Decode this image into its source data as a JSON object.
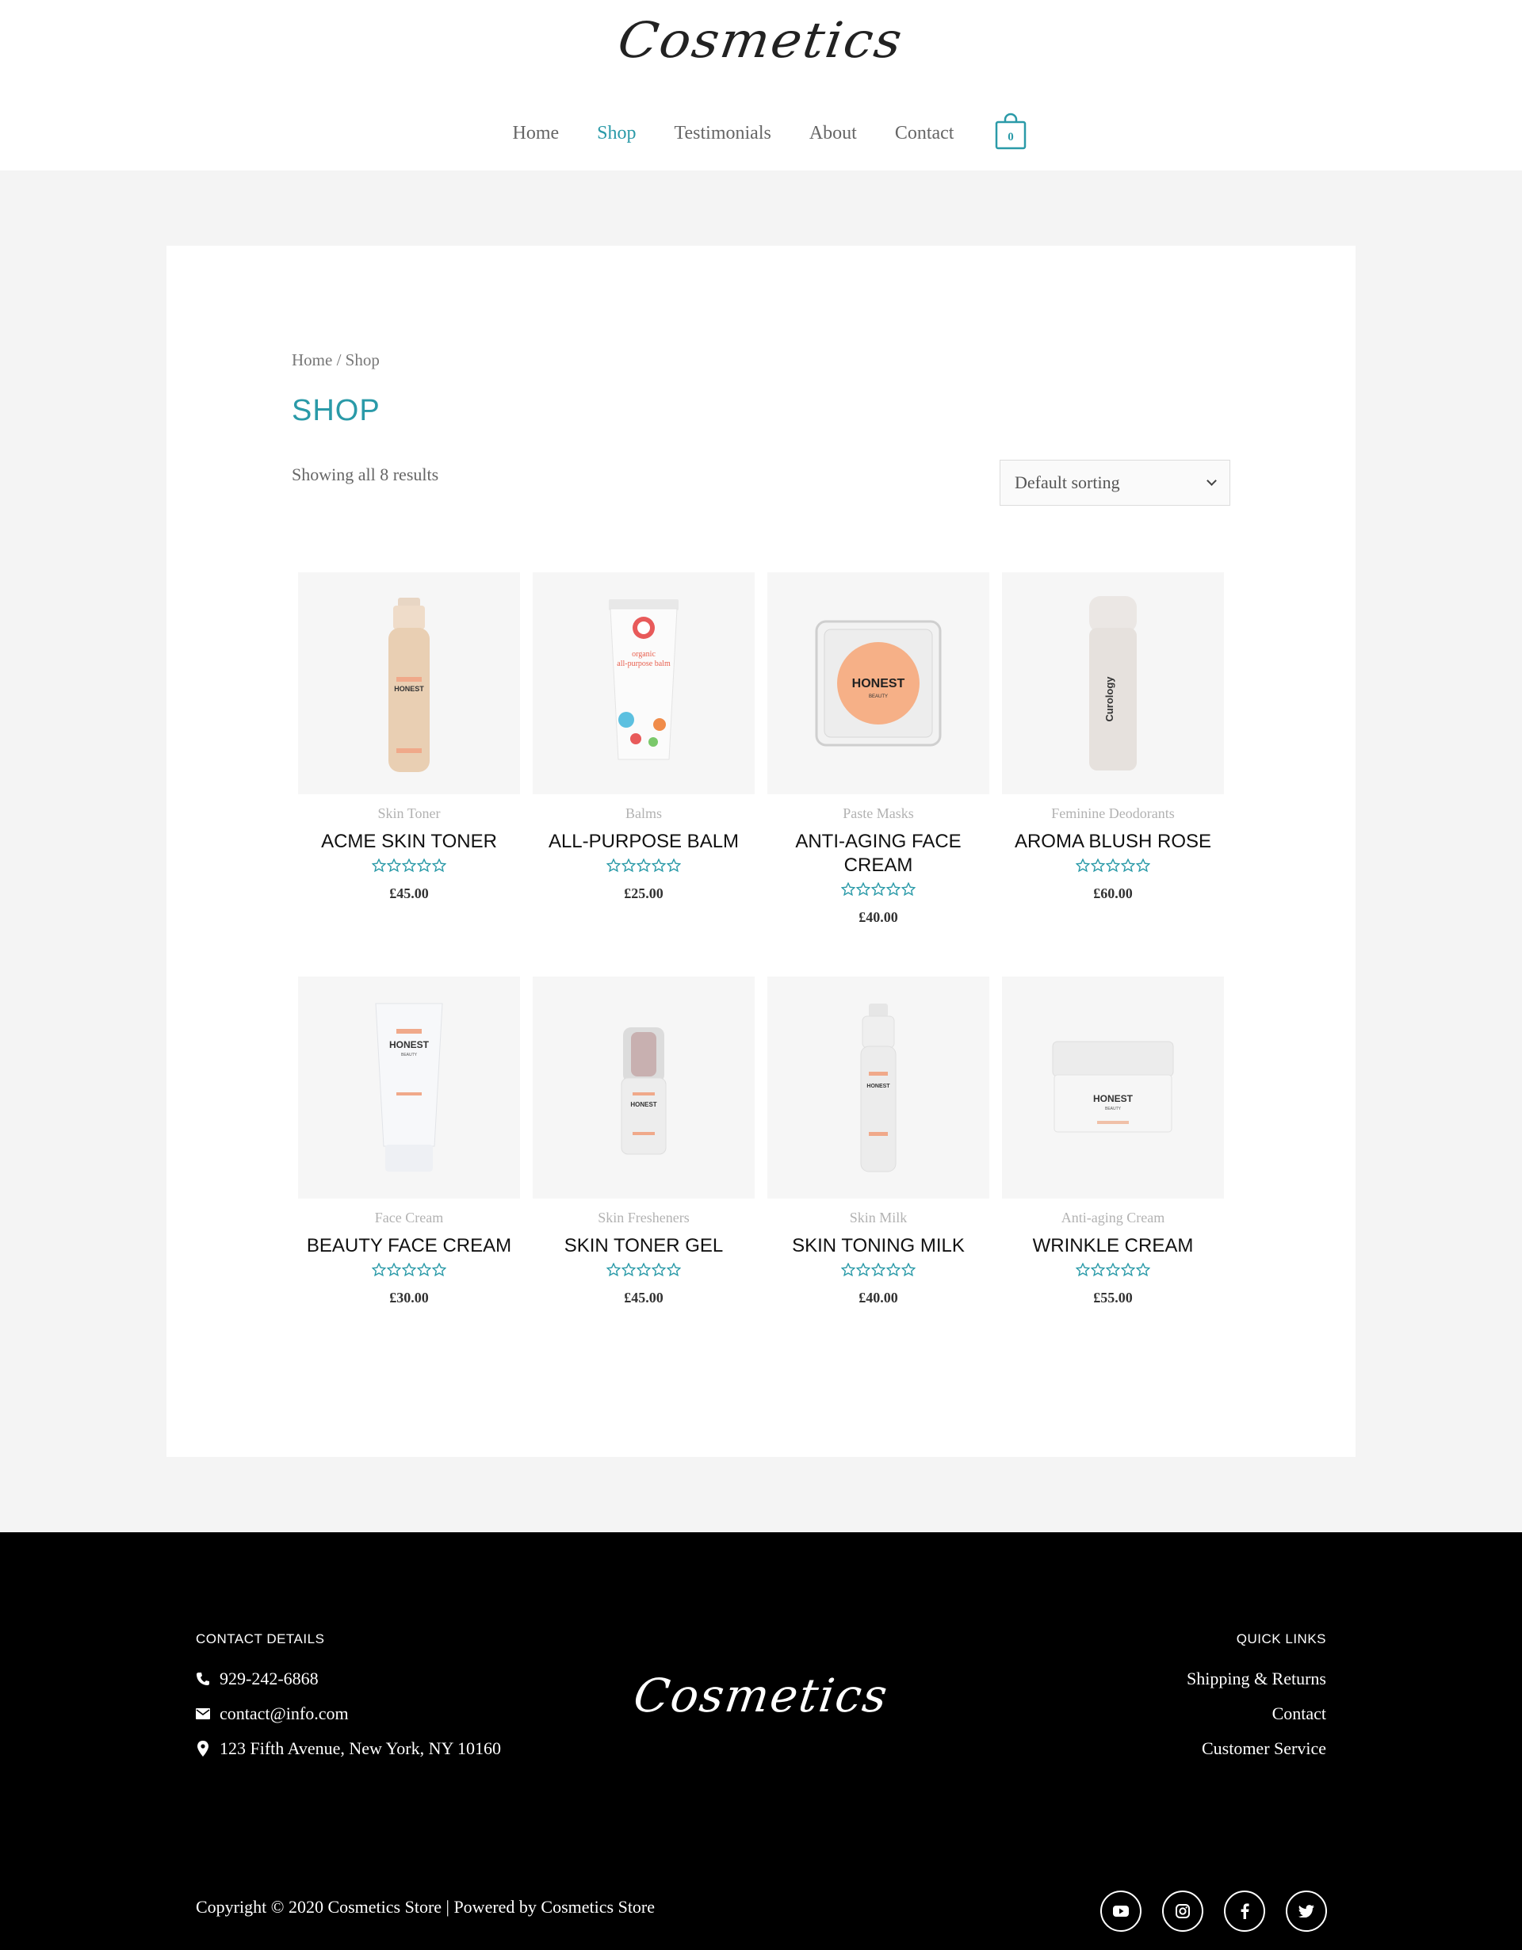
{
  "brand": {
    "name": "Cosmetics"
  },
  "nav": {
    "items": [
      {
        "label": "Home",
        "active": false
      },
      {
        "label": "Shop",
        "active": true
      },
      {
        "label": "Testimonials",
        "active": false
      },
      {
        "label": "About",
        "active": false
      },
      {
        "label": "Contact",
        "active": false
      }
    ],
    "cart_count": "0"
  },
  "breadcrumb": {
    "home": "Home",
    "separator": " / ",
    "current": "Shop"
  },
  "page": {
    "title": "SHOP",
    "result_count": "Showing all 8 results",
    "sorting": {
      "selected": "Default sorting"
    }
  },
  "products": [
    {
      "category": "Skin Toner",
      "title": "ACME SKIN TONER",
      "price": "£45.00",
      "rating_stars": "0 of 5"
    },
    {
      "category": "Balms",
      "title": "ALL-PURPOSE BALM",
      "price": "£25.00",
      "rating_stars": "0 of 5"
    },
    {
      "category": "Paste Masks",
      "title": "ANTI-AGING FACE CREAM",
      "price": "£40.00",
      "rating_stars": "0 of 5"
    },
    {
      "category": "Feminine Deodorants",
      "title": "AROMA BLUSH ROSE",
      "price": "£60.00",
      "rating_stars": "0 of 5"
    },
    {
      "category": "Face Cream",
      "title": "BEAUTY FACE CREAM",
      "price": "£30.00",
      "rating_stars": "0 of 5"
    },
    {
      "category": "Skin Fresheners",
      "title": "SKIN TONER GEL",
      "price": "£45.00",
      "rating_stars": "0 of 5"
    },
    {
      "category": "Skin Milk",
      "title": "SKIN TONING MILK",
      "price": "£40.00",
      "rating_stars": "0 of 5"
    },
    {
      "category": "Anti-aging Cream",
      "title": "WRINKLE CREAM",
      "price": "£55.00",
      "rating_stars": "0 of 5"
    }
  ],
  "product_labels": {
    "honest": "HONEST",
    "honest_sub": "BEAUTY",
    "balm_line1": "organic",
    "balm_line2": "all-purpose balm",
    "curology": "Curology"
  },
  "footer": {
    "contact_heading": "CONTACT DETAILS",
    "phone": "929-242-6868",
    "email": "contact@info.com",
    "address": "123 Fifth Avenue, New York, NY 10160",
    "quick_heading": "QUICK LINKS",
    "quick_links": [
      "Shipping & Returns",
      "Contact",
      "Customer Service"
    ],
    "copyright": "Copyright © 2020 Cosmetics Store | Powered by Cosmetics Store",
    "social_icons": [
      "youtube-icon",
      "instagram-icon",
      "facebook-icon",
      "twitter-icon"
    ]
  },
  "colors": {
    "accent": "#2a9aa8",
    "footer_bg": "#000000",
    "page_bg": "#f4f4f4"
  }
}
